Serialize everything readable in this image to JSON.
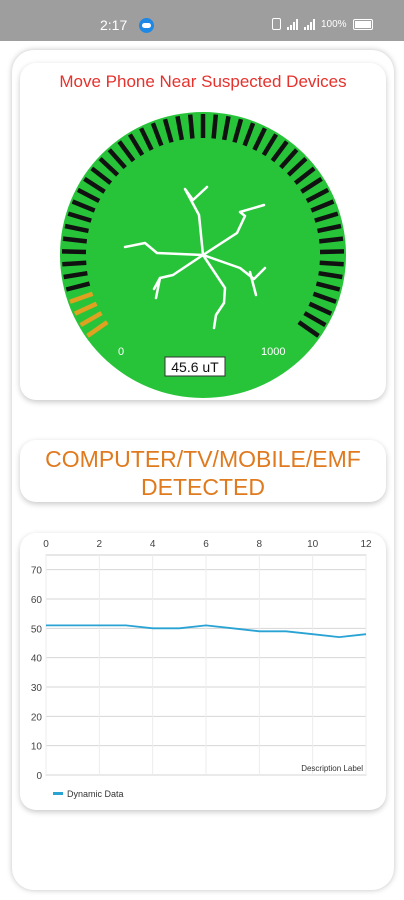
{
  "status_bar": {
    "time": "2:17",
    "battery": "100%"
  },
  "gauge": {
    "title": "Move Phone Near Suspected Devices",
    "value_label": "45.6 uT",
    "min_label": "0",
    "max_label": "1000",
    "value": 45.6,
    "min": 0,
    "max": 1000,
    "colors": {
      "dial": "#27c43a",
      "ticks": "#111111",
      "active_ticks": "#e0a020",
      "title": "#e5322d"
    },
    "icon": "lightning-network-icon"
  },
  "detection": {
    "message": "COMPUTER/TV/MOBILE/EMF\nDETECTED",
    "color": "#e07a1f"
  },
  "chart_data": {
    "type": "line",
    "x": [
      0,
      1,
      2,
      3,
      4,
      5,
      6,
      7,
      8,
      9,
      10,
      11,
      12
    ],
    "series": [
      {
        "name": "Dynamic Data",
        "values": [
          51,
          51,
          51,
          51,
          50,
          50,
          51,
          50,
          49,
          49,
          48,
          47,
          48
        ],
        "color": "#29a3d4"
      }
    ],
    "xlim": [
      0,
      12
    ],
    "ylim": [
      0,
      75
    ],
    "x_ticks": [
      "0",
      "2",
      "4",
      "6",
      "8",
      "10",
      "12"
    ],
    "y_ticks": [
      "0",
      "10",
      "20",
      "30",
      "40",
      "50",
      "60",
      "70"
    ],
    "x_axis_position": "top",
    "description": "Description Label",
    "grid": true,
    "legend_position": "bottom-left"
  }
}
